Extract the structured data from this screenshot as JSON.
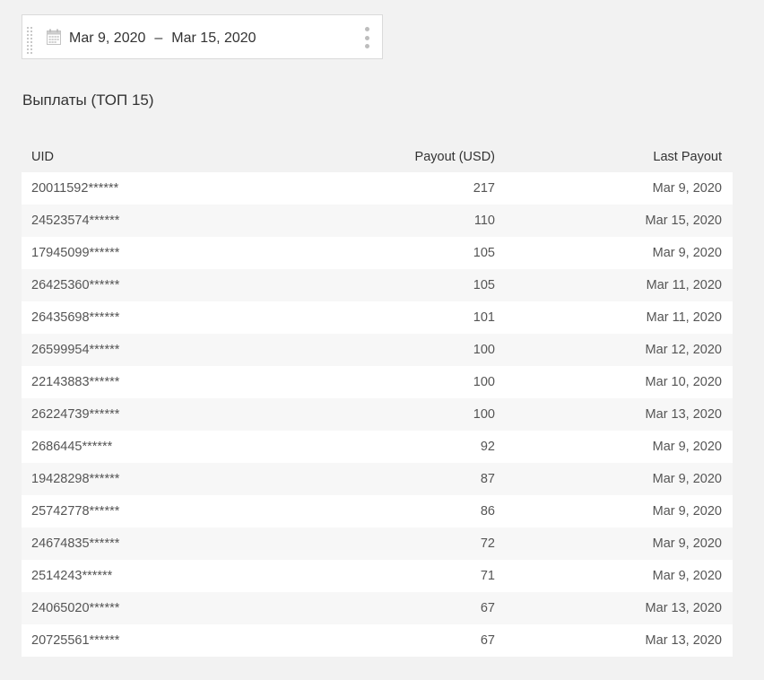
{
  "date_range": {
    "start": "Mar 9, 2020",
    "separator": "–",
    "end": "Mar 15, 2020"
  },
  "icons": {
    "calendar": "calendar-icon",
    "handle": "drag-handle-icon",
    "menu": "more-vertical-icon"
  },
  "section_title": "Выплаты (ТОП 15)",
  "table": {
    "headers": {
      "uid": "UID",
      "payout": "Payout (USD)",
      "last_payout": "Last Payout"
    },
    "rows": [
      {
        "uid": "20011592******",
        "payout": "217",
        "last_payout": "Mar 9, 2020"
      },
      {
        "uid": "24523574******",
        "payout": "110",
        "last_payout": "Mar 15, 2020"
      },
      {
        "uid": "17945099******",
        "payout": "105",
        "last_payout": "Mar 9, 2020"
      },
      {
        "uid": "26425360******",
        "payout": "105",
        "last_payout": "Mar 11, 2020"
      },
      {
        "uid": "26435698******",
        "payout": "101",
        "last_payout": "Mar 11, 2020"
      },
      {
        "uid": "26599954******",
        "payout": "100",
        "last_payout": "Mar 12, 2020"
      },
      {
        "uid": "22143883******",
        "payout": "100",
        "last_payout": "Mar 10, 2020"
      },
      {
        "uid": "26224739******",
        "payout": "100",
        "last_payout": "Mar 13, 2020"
      },
      {
        "uid": "2686445******",
        "payout": "92",
        "last_payout": "Mar 9, 2020"
      },
      {
        "uid": "19428298******",
        "payout": "87",
        "last_payout": "Mar 9, 2020"
      },
      {
        "uid": "25742778******",
        "payout": "86",
        "last_payout": "Mar 9, 2020"
      },
      {
        "uid": "24674835******",
        "payout": "72",
        "last_payout": "Mar 9, 2020"
      },
      {
        "uid": "2514243******",
        "payout": "71",
        "last_payout": "Mar 9, 2020"
      },
      {
        "uid": "24065020******",
        "payout": "67",
        "last_payout": "Mar 13, 2020"
      },
      {
        "uid": "20725561******",
        "payout": "67",
        "last_payout": "Mar 13, 2020"
      }
    ]
  }
}
